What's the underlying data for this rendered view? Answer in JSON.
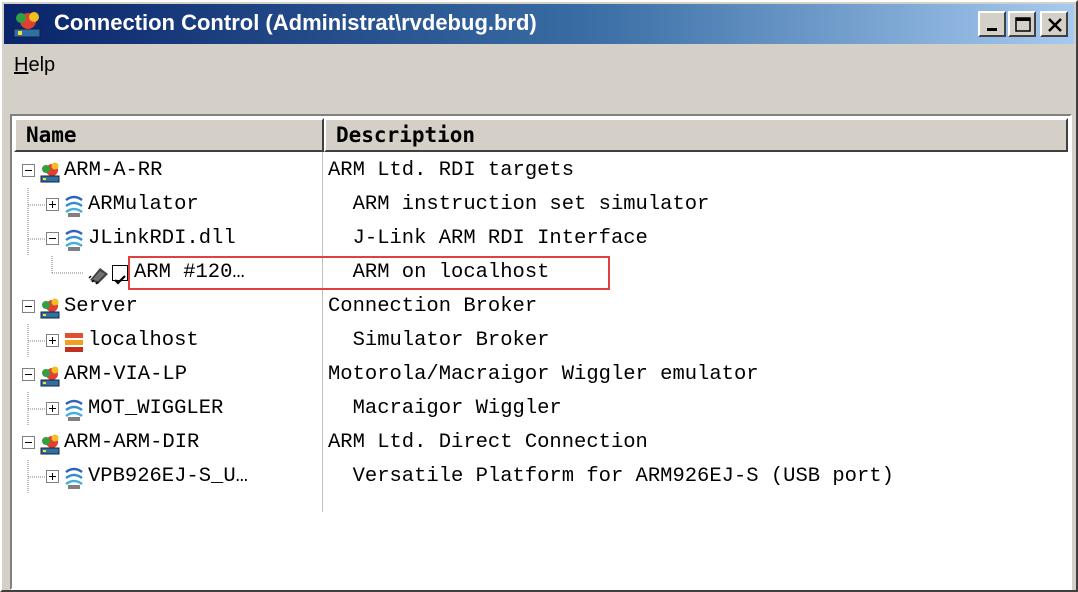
{
  "window": {
    "title": "Connection Control (Administrat\\rvdebug.brd)"
  },
  "menu": {
    "help_first": "H",
    "help_rest": "elp"
  },
  "columns": {
    "name": "Name",
    "description": "Description"
  },
  "rows": [
    {
      "name": "ARM-A-RR",
      "description": "ARM Ltd. RDI targets",
      "level": 0,
      "expander": "minus",
      "icon": "network-node-icon"
    },
    {
      "name": "ARMulator",
      "description": "  ARM instruction set simulator",
      "level": 1,
      "expander": "plus",
      "icon": "driver-icon"
    },
    {
      "name": "JLinkRDI.dll",
      "description": "  J-Link ARM RDI Interface",
      "level": 1,
      "expander": "minus",
      "icon": "driver-icon"
    },
    {
      "name": "ARM #120…",
      "description": "  ARM on localhost",
      "level": 2,
      "expander": "none",
      "icon": "chip-icon",
      "checked": true
    },
    {
      "name": "Server",
      "description": "Connection Broker",
      "level": 0,
      "expander": "minus",
      "icon": "network-node-icon"
    },
    {
      "name": "localhost",
      "description": "  Simulator Broker",
      "level": 1,
      "expander": "plus",
      "icon": "broker-icon"
    },
    {
      "name": "ARM-VIA-LP",
      "description": "Motorola/Macraigor Wiggler emulator",
      "level": 0,
      "expander": "minus",
      "icon": "network-node-icon"
    },
    {
      "name": "MOT_WIGGLER",
      "description": "  Macraigor Wiggler",
      "level": 1,
      "expander": "plus",
      "icon": "driver-icon"
    },
    {
      "name": "ARM-ARM-DIR",
      "description": "ARM Ltd. Direct Connection",
      "level": 0,
      "expander": "minus",
      "icon": "network-node-icon"
    },
    {
      "name": "VPB926EJ-S_U…",
      "description": "  Versatile Platform for ARM926EJ-S (USB port)",
      "level": 1,
      "expander": "plus",
      "icon": "driver-icon"
    }
  ],
  "colors": {
    "titlebar_start": "#0a246a",
    "titlebar_end": "#a6caf0",
    "highlight_box": "#e04040"
  }
}
